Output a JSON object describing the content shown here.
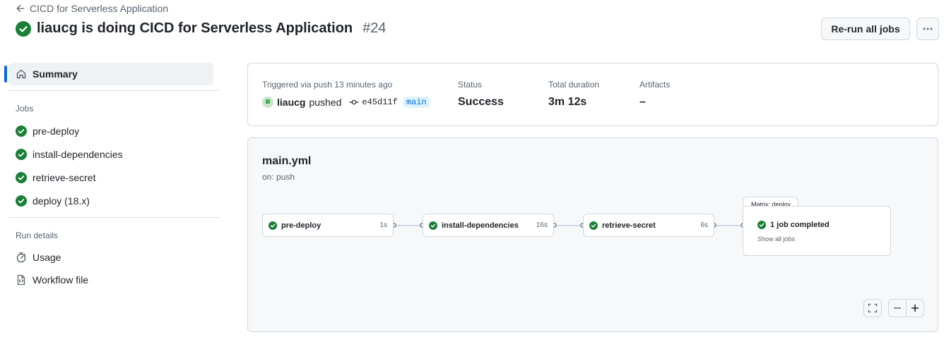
{
  "header": {
    "back_label": "CICD for Serverless Application",
    "title": "liaucg is doing CICD for Serverless Application",
    "run_number": "#24",
    "rerun_label": "Re-run all jobs"
  },
  "sidebar": {
    "summary_label": "Summary",
    "jobs_heading": "Jobs",
    "jobs": [
      {
        "label": "pre-deploy",
        "status": "success"
      },
      {
        "label": "install-dependencies",
        "status": "success"
      },
      {
        "label": "retrieve-secret",
        "status": "success"
      },
      {
        "label": "deploy (18.x)",
        "status": "success"
      }
    ],
    "run_details_heading": "Run details",
    "run_details": [
      {
        "label": "Usage",
        "icon": "stopwatch-icon"
      },
      {
        "label": "Workflow file",
        "icon": "file-code-icon"
      }
    ]
  },
  "summary": {
    "triggered_label": "Triggered via push 13 minutes ago",
    "user": "liaucg",
    "action": "pushed",
    "commit": "e45d11f",
    "branch": "main",
    "status_label": "Status",
    "status_value": "Success",
    "duration_label": "Total duration",
    "duration_value": "3m 12s",
    "artifacts_label": "Artifacts",
    "artifacts_value": "–"
  },
  "workflow": {
    "file": "main.yml",
    "trigger": "on: push",
    "jobs": [
      {
        "name": "pre-deploy",
        "duration": "1s"
      },
      {
        "name": "install-dependencies",
        "duration": "16s"
      },
      {
        "name": "retrieve-secret",
        "duration": "6s"
      }
    ],
    "matrix": {
      "tab_label": "Matrix: deploy",
      "status_text": "1 job completed",
      "link_text": "Show all jobs"
    }
  },
  "colors": {
    "success": "#1a7f37",
    "accent": "#0969da",
    "border": "#d1d9e0"
  }
}
